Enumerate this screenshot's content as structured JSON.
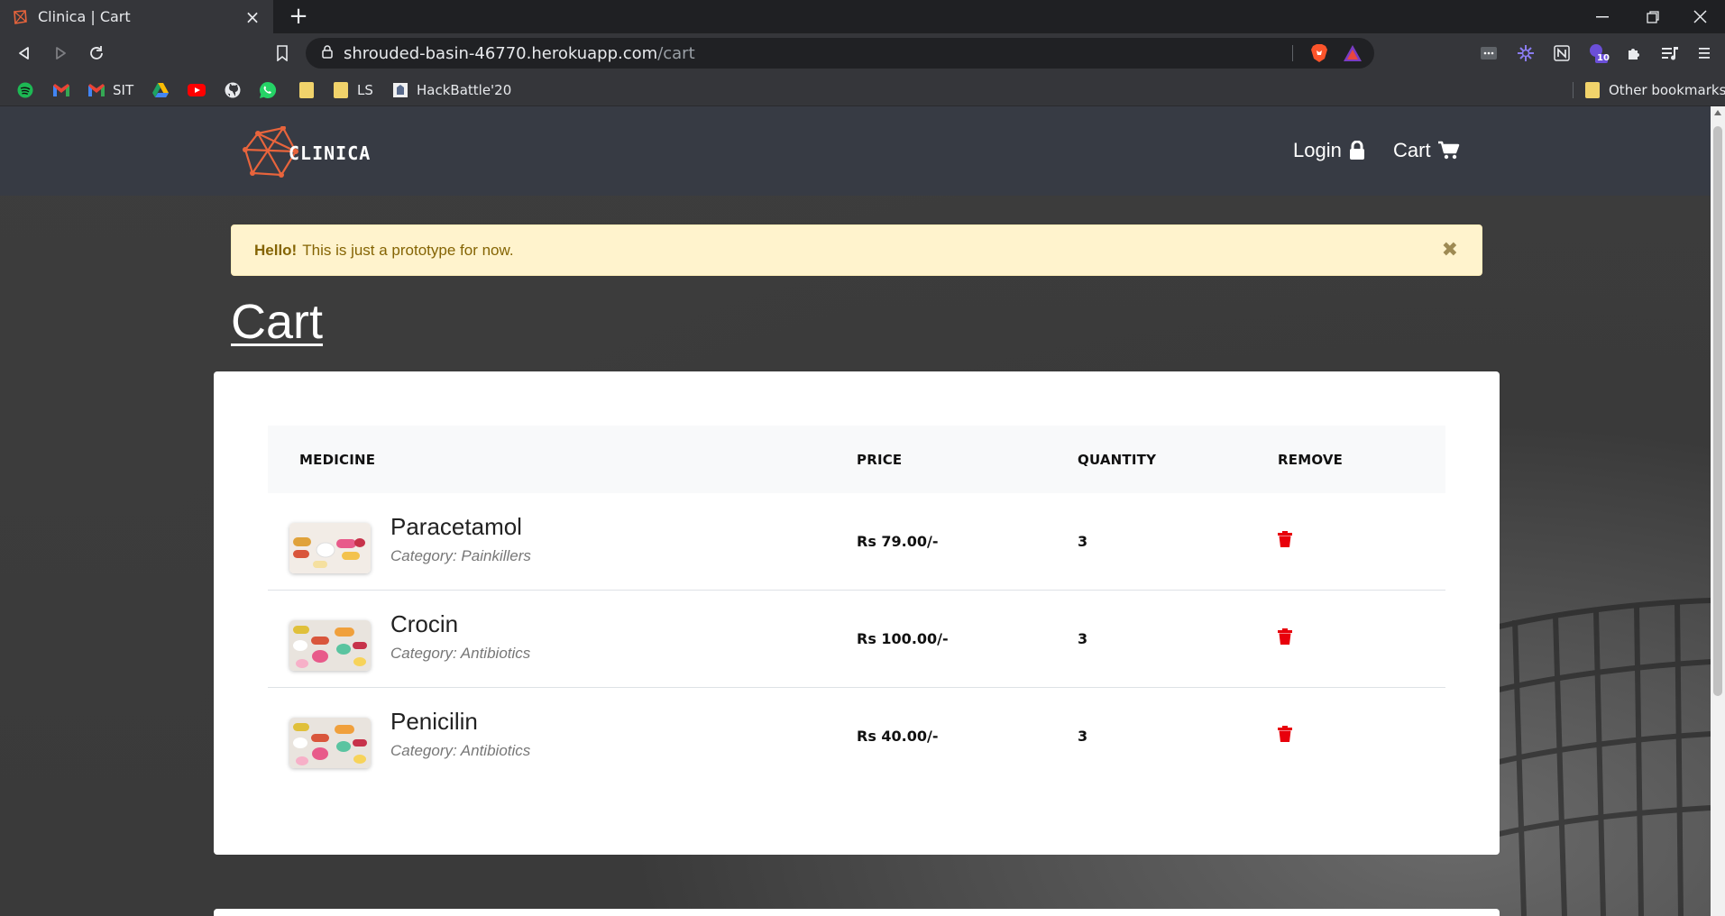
{
  "browser": {
    "tab_title": "Clinica | Cart",
    "tab_close": "×",
    "new_tab": "+",
    "url_host": "shrouded-basin-46770.herokuapp.com",
    "url_path": "/cart",
    "extension_badge": "10",
    "bookmarks": [
      {
        "label": "",
        "icon": "spotify-icon"
      },
      {
        "label": "",
        "icon": "gmail-icon"
      },
      {
        "label": "SIT",
        "icon": "gmail-icon"
      },
      {
        "label": "",
        "icon": "google-drive-icon"
      },
      {
        "label": "",
        "icon": "youtube-icon"
      },
      {
        "label": "",
        "icon": "github-icon"
      },
      {
        "label": "",
        "icon": "whatsapp-icon"
      },
      {
        "label": "",
        "icon": "folder-icon"
      },
      {
        "label": "LS",
        "icon": "folder-icon"
      },
      {
        "label": "HackBattle'20",
        "icon": "page-icon"
      }
    ],
    "other_bookmarks": "Other bookmarks"
  },
  "site": {
    "logo_text": "CLINICA",
    "nav": {
      "login": "Login",
      "cart": "Cart"
    }
  },
  "alert": {
    "strong": "Hello!",
    "text": "This is just a prototype for now.",
    "close": "✖"
  },
  "page_title": "Cart",
  "table": {
    "headers": {
      "medicine": "MEDICINE",
      "price": "PRICE",
      "quantity": "QUANTITY",
      "remove": "REMOVE"
    },
    "rows": [
      {
        "name": "Paracetamol",
        "category": "Category: Painkillers",
        "price": "Rs 79.00/-",
        "quantity": "3"
      },
      {
        "name": "Crocin",
        "category": "Category: Antibiotics",
        "price": "Rs 100.00/-",
        "quantity": "3"
      },
      {
        "name": "Penicilin",
        "category": "Category: Antibiotics",
        "price": "Rs 40.00/-",
        "quantity": "3"
      }
    ]
  },
  "colors": {
    "navbar": "#373b44",
    "alert_bg": "#fff3cd",
    "alert_text": "#856404",
    "delete": "#e8000b"
  }
}
